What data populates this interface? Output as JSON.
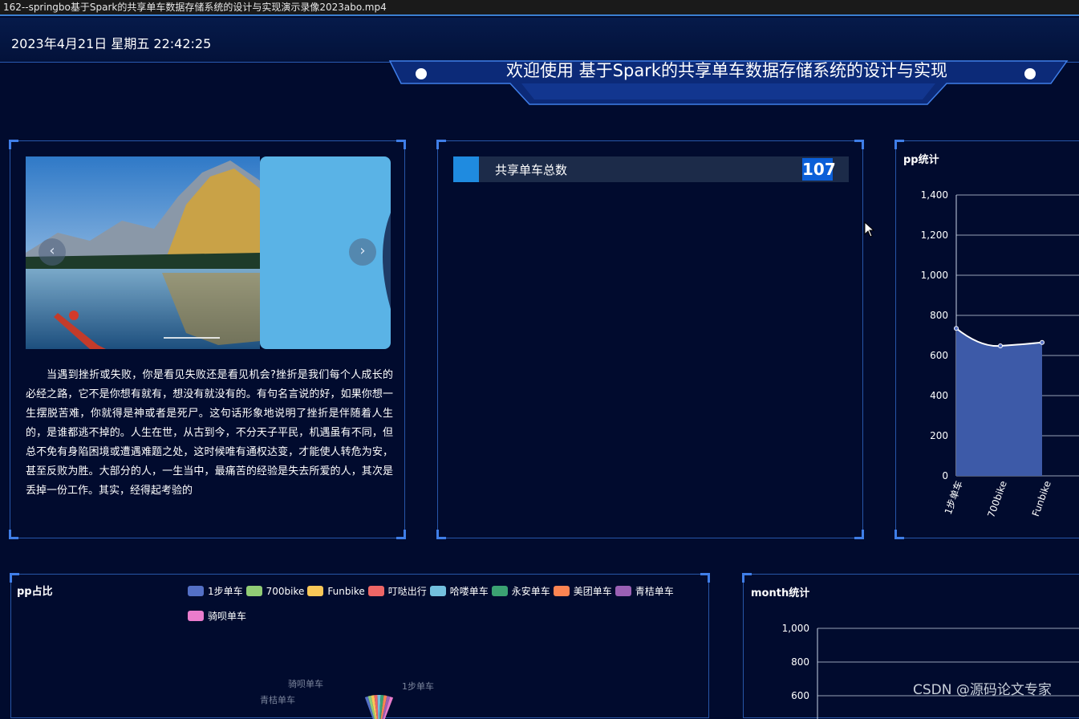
{
  "window": {
    "title": "162--springbo基于Spark的共享单车数据存储系统的设计与实现演示录像2023abo.mp4"
  },
  "header": {
    "datetime": "2023年4月21日 星期五 22:42:25",
    "title": "欢迎使用 基于Spark的共享单车数据存储系统的设计与实现"
  },
  "carousel": {
    "prev_icon": "chevron-left-icon",
    "next_icon": "chevron-right-icon",
    "prev_glyph": "‹",
    "next_glyph": "›"
  },
  "article": {
    "text": "当遇到挫折或失败，你是看见失败还是看见机会?挫折是我们每个人成长的必经之路，它不是你想有就有，想没有就没有的。有句名言说的好，如果你想一生摆脱苦难，你就得是神或者是死尸。这句话形象地说明了挫折是伴随着人生的，是谁都逃不掉的。人生在世，从古到今，不分天子平民，机遇虽有不同，但总不免有身陷困境或遭遇难题之处，这时候唯有通权达变，才能使人转危为安，甚至反败为胜。大部分的人，一生当中，最痛苦的经验是失去所爱的人，其次是丢掉一份工作。其实，经得起考验的"
  },
  "stats": {
    "label": "共享单车总数",
    "value": "107"
  },
  "pp_chart": {
    "title": "pp统计",
    "chart_data": {
      "type": "area",
      "categories": [
        "1步单车",
        "700bike",
        "Funbike"
      ],
      "values": [
        735,
        648,
        665
      ],
      "ylim": [
        0,
        1400
      ],
      "yticks": [
        "0",
        "200",
        "400",
        "600",
        "800",
        "1,000",
        "1,200",
        "1,400"
      ]
    }
  },
  "pie_chart": {
    "title": "pp占比",
    "legend": [
      {
        "name": "1步单车",
        "color": "#5470c6"
      },
      {
        "name": "700bike",
        "color": "#91cc75"
      },
      {
        "name": "Funbike",
        "color": "#fac858"
      },
      {
        "name": "叮哒出行",
        "color": "#ee6666"
      },
      {
        "name": "哈喽单车",
        "color": "#73c0de"
      },
      {
        "name": "永安单车",
        "color": "#3ba272"
      },
      {
        "name": "美团单车",
        "color": "#fc8452"
      },
      {
        "name": "青桔单车",
        "color": "#9a60b4"
      },
      {
        "name": "骑呗单车",
        "color": "#ea7ccc"
      }
    ],
    "visible_labels": [
      "骑呗单车",
      "青桔单车",
      "1步单车"
    ]
  },
  "month_chart": {
    "title": "month统计",
    "chart_data": {
      "type": "line",
      "yticks": [
        "600",
        "800",
        "1,000"
      ],
      "ylim": [
        600,
        1000
      ]
    }
  },
  "watermark": "CSDN @源码论文专家",
  "colors": {
    "accent": "#3f7ee8",
    "background": "#010b2e",
    "stat_blue": "#1f8be0"
  }
}
